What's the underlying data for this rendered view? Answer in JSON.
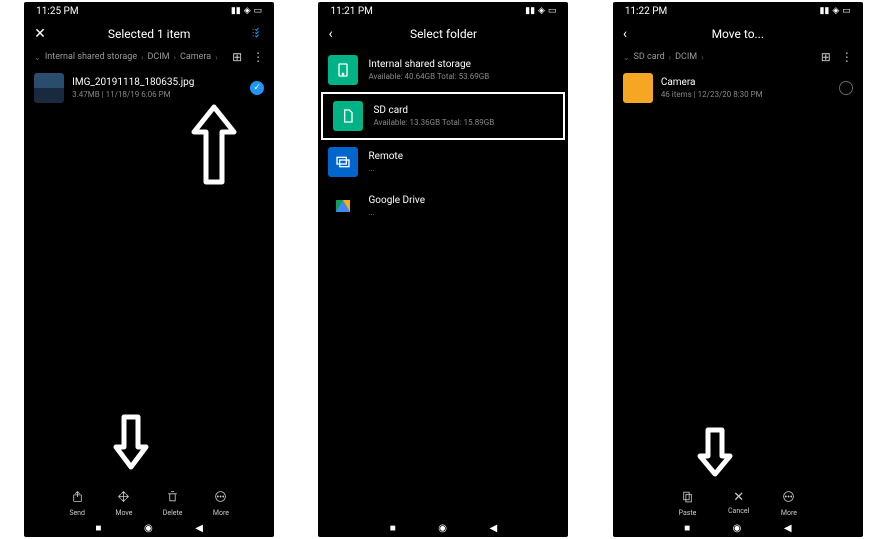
{
  "screen1": {
    "time": "11:25 PM",
    "title": "Selected 1 item",
    "breadcrumb": [
      "Internal shared storage",
      "DCIM",
      "Camera"
    ],
    "file": {
      "name": "IMG_20191118_180635.jpg",
      "meta": "3.47MB | 11/18/19 6:06 PM"
    },
    "actions": {
      "send": "Send",
      "move": "Move",
      "delete": "Delete",
      "more": "More"
    }
  },
  "screen2": {
    "time": "11:21 PM",
    "title": "Select folder",
    "options": [
      {
        "name": "Internal shared storage",
        "meta": "Available: 40.64GB Total: 53.69GB"
      },
      {
        "name": "SD card",
        "meta": "Available: 13.36GB Total: 15.89GB"
      },
      {
        "name": "Remote",
        "meta": "..."
      },
      {
        "name": "Google Drive",
        "meta": "..."
      }
    ]
  },
  "screen3": {
    "time": "11:22 PM",
    "title": "Move to...",
    "breadcrumb": [
      "SD card",
      "DCIM"
    ],
    "folder": {
      "name": "Camera",
      "meta": "46 items | 12/23/20 8:30 PM"
    },
    "actions": {
      "paste": "Paste",
      "cancel": "Cancel",
      "more": "More"
    }
  }
}
